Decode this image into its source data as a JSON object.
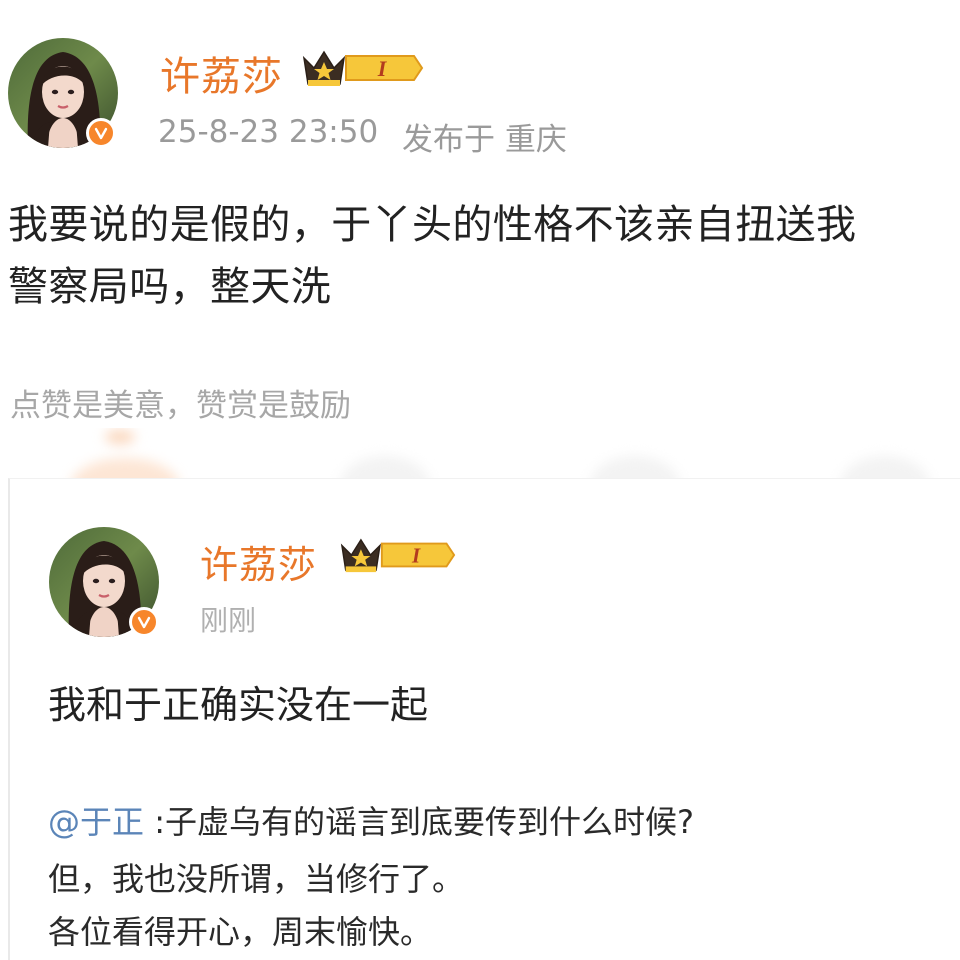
{
  "post": {
    "author_name": "许荔莎",
    "crown_level": "I",
    "timestamp": "25-8-23 23:50",
    "location_label": "发布于 重庆",
    "text_line1": "我要说的是假的，于丫头的性格不该亲自扭送我",
    "text_line2": "警察局吗，整天洗",
    "reward_hint": "点赞是美意，赞赏是鼓励"
  },
  "embedded_post": {
    "author_name": "许荔莎",
    "crown_level": "I",
    "timestamp": "刚刚",
    "text": "我和于正确实没在一起",
    "mention": "@于正",
    "quote_line1": " :子虚乌有的谣言到底要传到什么时候?",
    "quote_line2": "但，我也没所谓，当修行了。",
    "quote_line3": "各位看得开心，周末愉快。"
  },
  "colors": {
    "name_orange": "#e8772a",
    "verified_badge": "#f7862b",
    "mention_blue": "#5b85b8",
    "meta_gray": "#9a9a9a"
  },
  "icons": [
    "avatar",
    "verified-v-icon",
    "crown-level-badge-icon"
  ]
}
